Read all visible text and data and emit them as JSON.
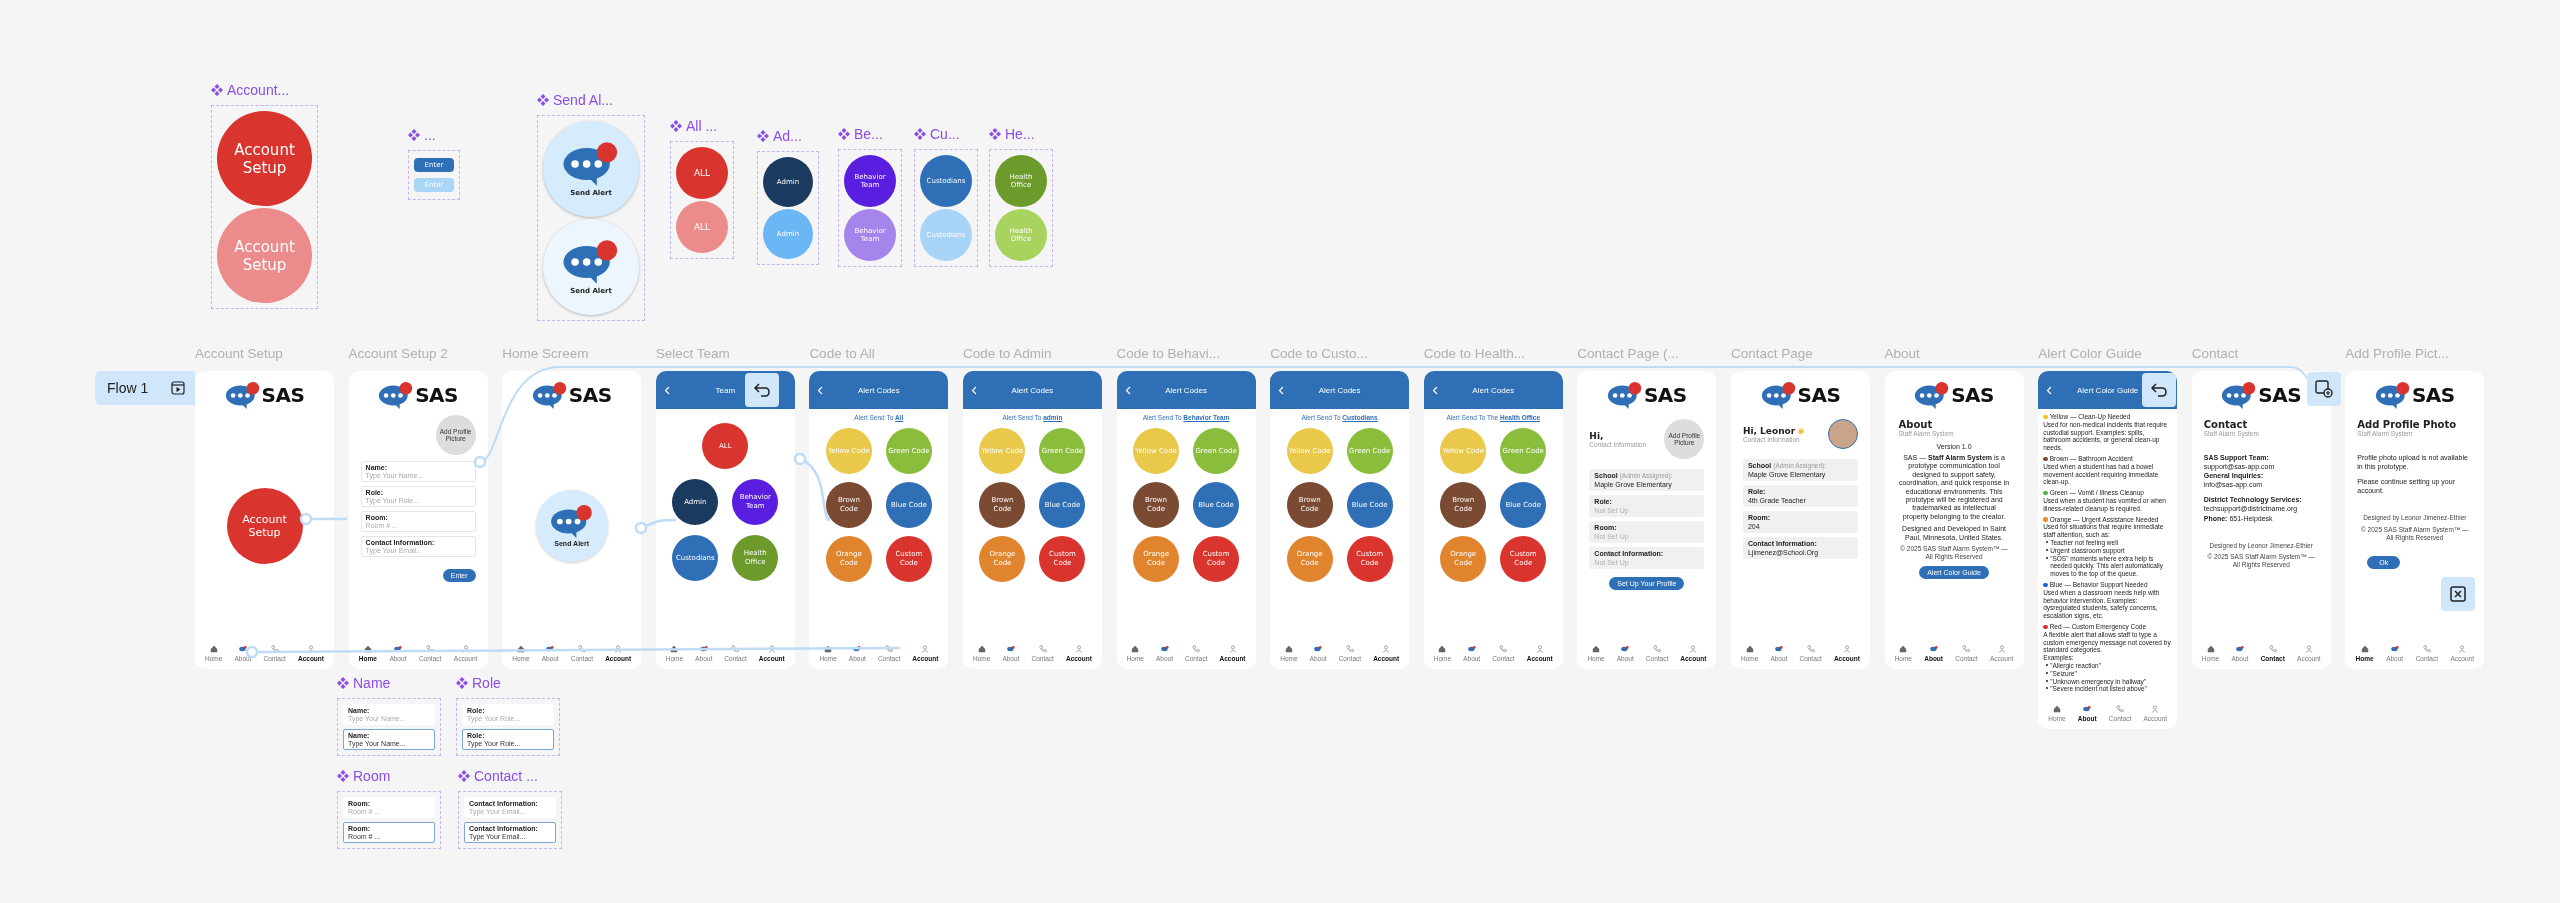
{
  "component_sets": [
    {
      "title": "Account...",
      "variants": [
        {
          "kind": "circle",
          "label": "Account Setup",
          "color": "#d9342e"
        },
        {
          "kind": "circle",
          "label": "Account Setup",
          "color": "#ec8b8b"
        }
      ]
    },
    {
      "title": "...",
      "variants": [
        {
          "kind": "pill",
          "label": "Enter",
          "color": "#2f6fb5"
        },
        {
          "kind": "pill",
          "label": "Enter",
          "color": "#a9d5f7"
        }
      ]
    },
    {
      "title": "Send Al...",
      "variants": [
        {
          "kind": "alert",
          "label": "Send Alert",
          "color": "#d6ebfb"
        },
        {
          "kind": "alert",
          "label": "Send Alert",
          "color": "#eef6fd"
        }
      ]
    },
    {
      "title": "All ...",
      "variants": [
        {
          "kind": "circle",
          "label": "ALL",
          "color": "#d9342e"
        },
        {
          "kind": "circle",
          "label": "ALL",
          "color": "#ec8b8b"
        }
      ]
    },
    {
      "title": "Ad...",
      "variants": [
        {
          "kind": "circle",
          "label": "Admin",
          "color": "#1b3a5f"
        },
        {
          "kind": "circle",
          "label": "Admin",
          "color": "#6bb6f5"
        }
      ]
    },
    {
      "title": "Be...",
      "variants": [
        {
          "kind": "circle",
          "label": "Behavior Team",
          "color": "#5a1ee0"
        },
        {
          "kind": "circle",
          "label": "Behavior Team",
          "color": "#a585ec"
        }
      ]
    },
    {
      "title": "Cu...",
      "variants": [
        {
          "kind": "circle",
          "label": "Custodians",
          "color": "#2f6fb5"
        },
        {
          "kind": "circle",
          "label": "Custodians",
          "color": "#a8d4f8"
        }
      ]
    },
    {
      "title": "He...",
      "variants": [
        {
          "kind": "circle",
          "label": "Health Office",
          "color": "#6c9a2b"
        },
        {
          "kind": "circle",
          "label": "Health Office",
          "color": "#a9d35f"
        }
      ]
    }
  ],
  "flow": {
    "label": "Flow 1"
  },
  "screens": [
    {
      "title": "Account Setup",
      "kind": "splash",
      "logo": "SAS",
      "button": "Account Setup",
      "nav": [
        {
          "label": "Home",
          "selected": false
        },
        {
          "label": "About",
          "selected": false
        },
        {
          "label": "Contact",
          "selected": false
        },
        {
          "label": "Account",
          "selected": true
        }
      ]
    },
    {
      "title": "Account Setup 2",
      "kind": "form",
      "logo": "SAS",
      "avatar": "Add Profile Picture",
      "fields": [
        {
          "label": "Name:",
          "placeholder": "Type Your Name..."
        },
        {
          "label": "Role:",
          "placeholder": "Type Your Role..."
        },
        {
          "label": "Room:",
          "placeholder": "Room # ..."
        },
        {
          "label": "Contact Information:",
          "placeholder": "Type Your Email..."
        }
      ],
      "button": "Enter",
      "nav": [
        {
          "label": "Home",
          "selected": true
        },
        {
          "label": "About",
          "selected": false
        },
        {
          "label": "Contact",
          "selected": false
        },
        {
          "label": "Account",
          "selected": false
        }
      ]
    },
    {
      "title": "Home Screem",
      "kind": "home",
      "logo": "SAS",
      "button": "Send Alert",
      "nav": [
        {
          "label": "Home",
          "selected": false
        },
        {
          "label": "About",
          "selected": false
        },
        {
          "label": "Contact",
          "selected": false
        },
        {
          "label": "Account",
          "selected": true
        }
      ]
    },
    {
      "title": "Select Team",
      "kind": "teams",
      "header": "Team",
      "teams": [
        {
          "label": "ALL",
          "color": "#d9342e"
        },
        {
          "label": "Admin",
          "color": "#1b3a5f"
        },
        {
          "label": "Behavior Team",
          "color": "#5a1ee0"
        },
        {
          "label": "Custodians",
          "color": "#2f6fb5"
        },
        {
          "label": "Health Office",
          "color": "#6c9a2b"
        }
      ],
      "nav": [
        {
          "label": "Home",
          "selected": false
        },
        {
          "label": "About",
          "selected": false
        },
        {
          "label": "Contact",
          "selected": false
        },
        {
          "label": "Account",
          "selected": true
        }
      ]
    },
    {
      "title": "Code to All",
      "kind": "codes",
      "header": "Alert Codes",
      "sent_to": "Alert Send To",
      "recipient": "All",
      "codes": [
        {
          "label": "Yellow Code",
          "color": "#e9c84a"
        },
        {
          "label": "Green Code",
          "color": "#8bbd3c"
        },
        {
          "label": "Brown Code",
          "color": "#7a4a32"
        },
        {
          "label": "Blue Code",
          "color": "#2f6fb5"
        },
        {
          "label": "Orange Code",
          "color": "#e0852e"
        },
        {
          "label": "Custom Code",
          "color": "#d9342e"
        }
      ],
      "nav": [
        {
          "label": "Home",
          "selected": false
        },
        {
          "label": "About",
          "selected": false
        },
        {
          "label": "Contact",
          "selected": false
        },
        {
          "label": "Account",
          "selected": true
        }
      ]
    },
    {
      "title": "Code to Admin",
      "kind": "codes",
      "header": "Alert Codes",
      "sent_to": "Alert Send To",
      "recipient": "admin",
      "codes": [
        {
          "label": "Yellow Code",
          "color": "#e9c84a"
        },
        {
          "label": "Green Code",
          "color": "#8bbd3c"
        },
        {
          "label": "Brown Code",
          "color": "#7a4a32"
        },
        {
          "label": "Blue Code",
          "color": "#2f6fb5"
        },
        {
          "label": "Orange Code",
          "color": "#e0852e"
        },
        {
          "label": "Custom Code",
          "color": "#d9342e"
        }
      ],
      "nav": [
        {
          "label": "Home",
          "selected": false
        },
        {
          "label": "About",
          "selected": false
        },
        {
          "label": "Contact",
          "selected": false
        },
        {
          "label": "Account",
          "selected": true
        }
      ]
    },
    {
      "title": "Code to Behavi...",
      "kind": "codes",
      "header": "Alert Codes",
      "sent_to": "Alert Send To",
      "recipient": "Behavior Team",
      "codes": [
        {
          "label": "Yellow Code",
          "color": "#e9c84a"
        },
        {
          "label": "Green Code",
          "color": "#8bbd3c"
        },
        {
          "label": "Brown Code",
          "color": "#7a4a32"
        },
        {
          "label": "Blue Code",
          "color": "#2f6fb5"
        },
        {
          "label": "Orange Code",
          "color": "#e0852e"
        },
        {
          "label": "Custom Code",
          "color": "#d9342e"
        }
      ],
      "nav": [
        {
          "label": "Home",
          "selected": false
        },
        {
          "label": "About",
          "selected": false
        },
        {
          "label": "Contact",
          "selected": false
        },
        {
          "label": "Account",
          "selected": true
        }
      ]
    },
    {
      "title": "Code to Custo...",
      "kind": "codes",
      "header": "Alert Codes",
      "sent_to": "Alert Send To",
      "recipient": "Custodians",
      "codes": [
        {
          "label": "Yellow Code",
          "color": "#e9c84a"
        },
        {
          "label": "Green Code",
          "color": "#8bbd3c"
        },
        {
          "label": "Brown Code",
          "color": "#7a4a32"
        },
        {
          "label": "Blue Code",
          "color": "#2f6fb5"
        },
        {
          "label": "Orange Code",
          "color": "#e0852e"
        },
        {
          "label": "Custom Code",
          "color": "#d9342e"
        }
      ],
      "nav": [
        {
          "label": "Home",
          "selected": false
        },
        {
          "label": "About",
          "selected": false
        },
        {
          "label": "Contact",
          "selected": false
        },
        {
          "label": "Account",
          "selected": true
        }
      ]
    },
    {
      "title": "Code to Health...",
      "kind": "codes",
      "header": "Alert Codes",
      "sent_to": "Alert Send To The",
      "recipient": "Health Office",
      "codes": [
        {
          "label": "Yellow Code",
          "color": "#e9c84a"
        },
        {
          "label": "Green Code",
          "color": "#8bbd3c"
        },
        {
          "label": "Brown Code",
          "color": "#7a4a32"
        },
        {
          "label": "Blue Code",
          "color": "#2f6fb5"
        },
        {
          "label": "Orange Code",
          "color": "#e0852e"
        },
        {
          "label": "Custom Code",
          "color": "#d9342e"
        }
      ],
      "nav": [
        {
          "label": "Home",
          "selected": false
        },
        {
          "label": "About",
          "selected": false
        },
        {
          "label": "Contact",
          "selected": false
        },
        {
          "label": "Account",
          "selected": true
        }
      ]
    },
    {
      "title": "Contact Page (...",
      "kind": "profile",
      "logo": "SAS",
      "greeting": "Hi,",
      "wave": false,
      "subtitle": "Contact Information",
      "avatar": {
        "kind": "placeholder",
        "label": "Add Profile Picture"
      },
      "fields": [
        {
          "label": "School",
          "note": "(Admin Assigned):",
          "value": "Maple Grove Elementary",
          "filled": true
        },
        {
          "label": "Role:",
          "value": "Not Set Up",
          "filled": false
        },
        {
          "label": "Room:",
          "value": "Not Set Up",
          "filled": false
        },
        {
          "label": "Contact Information:",
          "value": "Not Set Up",
          "filled": false
        }
      ],
      "button": "Set Up Your Profile",
      "nav": [
        {
          "label": "Home",
          "selected": false
        },
        {
          "label": "About",
          "selected": false
        },
        {
          "label": "Contact",
          "selected": false
        },
        {
          "label": "Account",
          "selected": true
        }
      ]
    },
    {
      "title": "Contact Page",
      "kind": "profile",
      "logo": "SAS",
      "greeting": "Hi, Leonor",
      "wave": true,
      "subtitle": "Contact Information",
      "avatar": {
        "kind": "photo"
      },
      "fields": [
        {
          "label": "School",
          "note": "(Admin Assigned):",
          "value": "Maple Grove Elementary",
          "filled": true
        },
        {
          "label": "Role:",
          "value": "4th Grade Teacher",
          "filled": true
        },
        {
          "label": "Room:",
          "value": "204",
          "filled": true
        },
        {
          "label": "Contact Information:",
          "value": "Ljimenez@School.Org",
          "filled": true
        }
      ],
      "nav": [
        {
          "label": "Home",
          "selected": false
        },
        {
          "label": "About",
          "selected": false
        },
        {
          "label": "Contact",
          "selected": false
        },
        {
          "label": "Account",
          "selected": true
        }
      ]
    },
    {
      "title": "About",
      "kind": "about",
      "logo": "SAS",
      "heading": "About",
      "subtitle": "Staff Alarm System",
      "version": "Version 1.0",
      "paragraph": "SAS — **Staff Alarm System** is a prototype communication tool designed to support safety, coordination, and quick response in educational environments. This prototype will be registered and trademarked as intellectual property belonging to the creator.",
      "location": "Designed and Developed in Saint Paul, Minnesota, United States.",
      "copyright": "© 2025 SAS Staff Alarm System™ — All Rights Reserved",
      "button": "Alert Color Guide",
      "nav": [
        {
          "label": "Home",
          "selected": false
        },
        {
          "label": "About",
          "selected": true
        },
        {
          "label": "Contact",
          "selected": false
        },
        {
          "label": "Account",
          "selected": false
        }
      ]
    },
    {
      "title": "Alert Color Guide",
      "kind": "guide",
      "header": "Alert Color Guide",
      "entries": [
        {
          "color": "#f2c418",
          "title": "Yellow — Clean-Up Needed",
          "text": "Used for non-medical incidents that require custodial support.  Examples: spills, bathroom accidents, or general clean-up needs."
        },
        {
          "color": "#7a4a32",
          "title": "Brown — Bathroom Accident",
          "text": "Used when a student has had a bowel movement accident requiring immediate clean-up."
        },
        {
          "color": "#47b83a",
          "title": "Green — Vomit / Illness Cleanup",
          "text": "Used when a student has vomited or when illness-related cleanup is required."
        },
        {
          "color": "#f08a24",
          "title": "Orange — Urgent Assistance Needed",
          "text": "Used for situations that require immediate staff attention, such as:",
          "bullets": [
            "Teacher not feeling well",
            "Urgent classroom support",
            "\"SOS\" moments where extra help is needed quickly. This alert automatically moves to the top of the queue."
          ]
        },
        {
          "color": "#1f5fd1",
          "title": "Blue — Behavior Support Needed",
          "text": "Used when a classroom needs help with behavior intervention. Examples: dysregulated students, safety concerns, escalation signs, etc."
        },
        {
          "color": "#d9342e",
          "title": "Red — Custom Emergency Code",
          "text": "A flexible alert that allows staff to type a custom emergency message not covered by standard categories.",
          "examples": "Examples:",
          "bullets": [
            "\"Allergic reaction\"",
            "\"Seizure\"",
            "\"Unknown emergency in hallway\"",
            "\"Severe incident not listed above\""
          ]
        }
      ],
      "nav": [
        {
          "label": "Home",
          "selected": false
        },
        {
          "label": "About",
          "selected": true
        },
        {
          "label": "Contact",
          "selected": false
        },
        {
          "label": "Account",
          "selected": false
        }
      ]
    },
    {
      "title": "Contact",
      "kind": "contact",
      "logo": "SAS",
      "heading": "Contact",
      "subtitle": "Staff Alarm System",
      "groups": [
        {
          "items": [
            {
              "inline": false,
              "label": "SAS Support Team:",
              "value": "support@sas-app.com"
            },
            {
              "inline": false,
              "label": "General Inquiries:",
              "value": "info@sas-app.com"
            }
          ]
        },
        {
          "items": [
            {
              "inline": false,
              "label": "District Technology Services:",
              "value": "techsupport@districtname.org"
            },
            {
              "inline": true,
              "label": "Phone:",
              "value": "651-Helpdesk"
            }
          ]
        }
      ],
      "footer": [
        "Designed by Leonor Jimenez-Ethier",
        "© 2025 SAS Staff Alarm System™ — All Rights Reserved"
      ],
      "nav": [
        {
          "label": "Home",
          "selected": false
        },
        {
          "label": "About",
          "selected": false
        },
        {
          "label": "Contact",
          "selected": true
        },
        {
          "label": "Account",
          "selected": false
        }
      ]
    },
    {
      "title": "Add Profile Pict...",
      "kind": "photo",
      "logo": "SAS",
      "heading": "Add Profile Photo",
      "subtitle": "Staff Alarm System",
      "paragraphs": [
        "Profile photo upload is not available in this prototype.",
        "Please continue setting up your account."
      ],
      "footer": [
        "Designed by Leonor Jimenez-Ethier",
        "© 2025 SAS Staff Alarm System™ — All Rights Reserved"
      ],
      "button": "Ok",
      "nav": [
        {
          "label": "Home",
          "selected": true
        },
        {
          "label": "About",
          "selected": false
        },
        {
          "label": "Contact",
          "selected": false
        },
        {
          "label": "Account",
          "selected": false
        }
      ]
    }
  ],
  "field_components": [
    {
      "title": "Name",
      "variants": [
        {
          "label": "Name:",
          "placeholder": "Type Your Name...",
          "focused": false
        },
        {
          "label": "Name:",
          "placeholder": "Type Your Name...",
          "focused": true
        }
      ]
    },
    {
      "title": "Role",
      "variants": [
        {
          "label": "Role:",
          "placeholder": "Type Your Role...",
          "focused": false
        },
        {
          "label": "Role:",
          "placeholder": "Type Your Role...",
          "focused": true
        }
      ]
    },
    {
      "title": "Room",
      "variants": [
        {
          "label": "Room:",
          "placeholder": "Room # ...",
          "focused": false
        },
        {
          "label": "Room:",
          "placeholder": "Room # ...",
          "focused": true
        }
      ]
    },
    {
      "title": "Contact ...",
      "variants": [
        {
          "label": "Contact Information:",
          "placeholder": "Type Your Email...",
          "focused": false
        },
        {
          "label": "Contact Information:",
          "placeholder": "Type Your Email...",
          "focused": true
        }
      ]
    }
  ]
}
